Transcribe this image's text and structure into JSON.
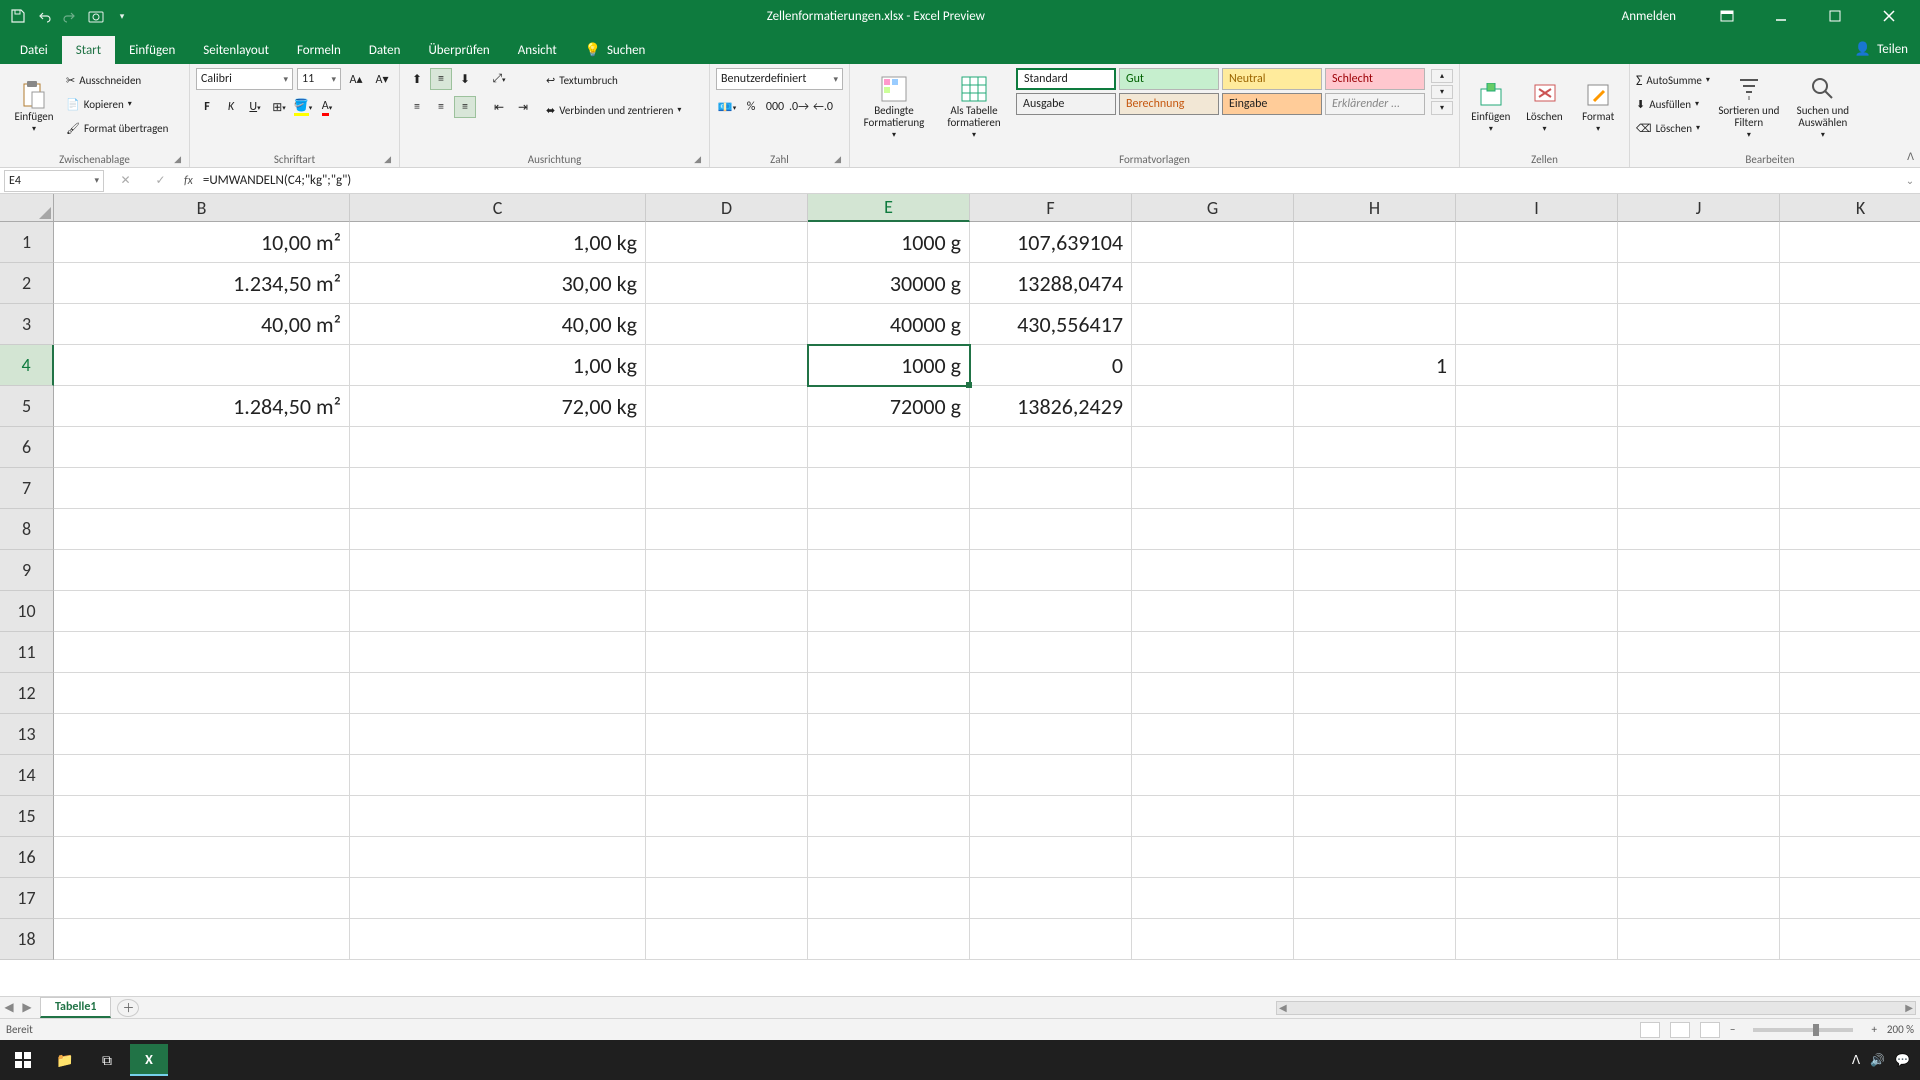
{
  "titlebar": {
    "title": "Zellenformatierungen.xlsx - Excel Preview",
    "signin": "Anmelden"
  },
  "tabs": {
    "file": "Datei",
    "start": "Start",
    "einfugen": "Einfügen",
    "seitenlayout": "Seitenlayout",
    "formeln": "Formeln",
    "daten": "Daten",
    "uberprufen": "Überprüfen",
    "ansicht": "Ansicht",
    "suchen": "Suchen",
    "teilen": "Teilen"
  },
  "ribbon": {
    "clipboard": {
      "paste": "Einfügen",
      "cut": "Ausschneiden",
      "copy": "Kopieren",
      "format_painter": "Format übertragen",
      "group": "Zwischenablage"
    },
    "font": {
      "name": "Calibri",
      "size": "11",
      "group": "Schriftart"
    },
    "alignment": {
      "wrap": "Textumbruch",
      "merge": "Verbinden und zentrieren",
      "group": "Ausrichtung"
    },
    "number": {
      "format": "Benutzerdefiniert",
      "group": "Zahl"
    },
    "styles": {
      "cond": "Bedingte\nFormatierung",
      "astable": "Als Tabelle\nformatieren",
      "standard": "Standard",
      "gut": "Gut",
      "neutral": "Neutral",
      "schlecht": "Schlecht",
      "ausgabe": "Ausgabe",
      "berechnung": "Berechnung",
      "eingabe": "Eingabe",
      "erklarend": "Erklärender ...",
      "group": "Formatvorlagen"
    },
    "cells": {
      "insert": "Einfügen",
      "delete": "Löschen",
      "format": "Format",
      "group": "Zellen"
    },
    "editing": {
      "autosum": "AutoSumme",
      "fill": "Ausfüllen",
      "clear": "Löschen",
      "sort": "Sortieren und\nFiltern",
      "find": "Suchen und\nAuswählen",
      "group": "Bearbeiten"
    }
  },
  "formulabar": {
    "cellref": "E4",
    "formula": "=UMWANDELN(C4;\"kg\";\"g\")"
  },
  "grid": {
    "columns": [
      "B",
      "C",
      "D",
      "E",
      "F",
      "G",
      "H",
      "I",
      "J",
      "K"
    ],
    "selected_col": "E",
    "selected_row": 4,
    "rows": [
      {
        "r": 1,
        "B": "10,00 m²",
        "C": "1,00 kg",
        "D": "",
        "E": "1000 g",
        "F": "107,639104",
        "G": "",
        "H": "",
        "I": "",
        "J": "",
        "K": ""
      },
      {
        "r": 2,
        "B": "1.234,50 m²",
        "C": "30,00 kg",
        "D": "",
        "E": "30000 g",
        "F": "13288,0474",
        "G": "",
        "H": "",
        "I": "",
        "J": "",
        "K": ""
      },
      {
        "r": 3,
        "B": "40,00 m²",
        "C": "40,00 kg",
        "D": "",
        "E": "40000 g",
        "F": "430,556417",
        "G": "",
        "H": "",
        "I": "",
        "J": "",
        "K": ""
      },
      {
        "r": 4,
        "B": "",
        "C": "1,00 kg",
        "D": "",
        "E": "1000 g",
        "F": "0",
        "G": "",
        "H": "1",
        "I": "",
        "J": "",
        "K": ""
      },
      {
        "r": 5,
        "B": "1.284,50 m²",
        "C": "72,00 kg",
        "D": "",
        "E": "72000 g",
        "F": "13826,2429",
        "G": "",
        "H": "",
        "I": "",
        "J": "",
        "K": ""
      },
      {
        "r": 6,
        "B": "",
        "C": "",
        "D": "",
        "E": "",
        "F": "",
        "G": "",
        "H": "",
        "I": "",
        "J": "",
        "K": ""
      },
      {
        "r": 7,
        "B": "",
        "C": "",
        "D": "",
        "E": "",
        "F": "",
        "G": "",
        "H": "",
        "I": "",
        "J": "",
        "K": ""
      },
      {
        "r": 8,
        "B": "",
        "C": "",
        "D": "",
        "E": "",
        "F": "",
        "G": "",
        "H": "",
        "I": "",
        "J": "",
        "K": ""
      },
      {
        "r": 9,
        "B": "",
        "C": "",
        "D": "",
        "E": "",
        "F": "",
        "G": "",
        "H": "",
        "I": "",
        "J": "",
        "K": ""
      },
      {
        "r": 10,
        "B": "",
        "C": "",
        "D": "",
        "E": "",
        "F": "",
        "G": "",
        "H": "",
        "I": "",
        "J": "",
        "K": ""
      },
      {
        "r": 11,
        "B": "",
        "C": "",
        "D": "",
        "E": "",
        "F": "",
        "G": "",
        "H": "",
        "I": "",
        "J": "",
        "K": ""
      },
      {
        "r": 12,
        "B": "",
        "C": "",
        "D": "",
        "E": "",
        "F": "",
        "G": "",
        "H": "",
        "I": "",
        "J": "",
        "K": ""
      },
      {
        "r": 13,
        "B": "",
        "C": "",
        "D": "",
        "E": "",
        "F": "",
        "G": "",
        "H": "",
        "I": "",
        "J": "",
        "K": ""
      },
      {
        "r": 14,
        "B": "",
        "C": "",
        "D": "",
        "E": "",
        "F": "",
        "G": "",
        "H": "",
        "I": "",
        "J": "",
        "K": ""
      },
      {
        "r": 15,
        "B": "",
        "C": "",
        "D": "",
        "E": "",
        "F": "",
        "G": "",
        "H": "",
        "I": "",
        "J": "",
        "K": ""
      },
      {
        "r": 16,
        "B": "",
        "C": "",
        "D": "",
        "E": "",
        "F": "",
        "G": "",
        "H": "",
        "I": "",
        "J": "",
        "K": ""
      },
      {
        "r": 17,
        "B": "",
        "C": "",
        "D": "",
        "E": "",
        "F": "",
        "G": "",
        "H": "",
        "I": "",
        "J": "",
        "K": ""
      },
      {
        "r": 18,
        "B": "",
        "C": "",
        "D": "",
        "E": "",
        "F": "",
        "G": "",
        "H": "",
        "I": "",
        "J": "",
        "K": ""
      }
    ]
  },
  "sheettabs": {
    "active": "Tabelle1"
  },
  "statusbar": {
    "ready": "Bereit",
    "zoom": "200 %"
  }
}
